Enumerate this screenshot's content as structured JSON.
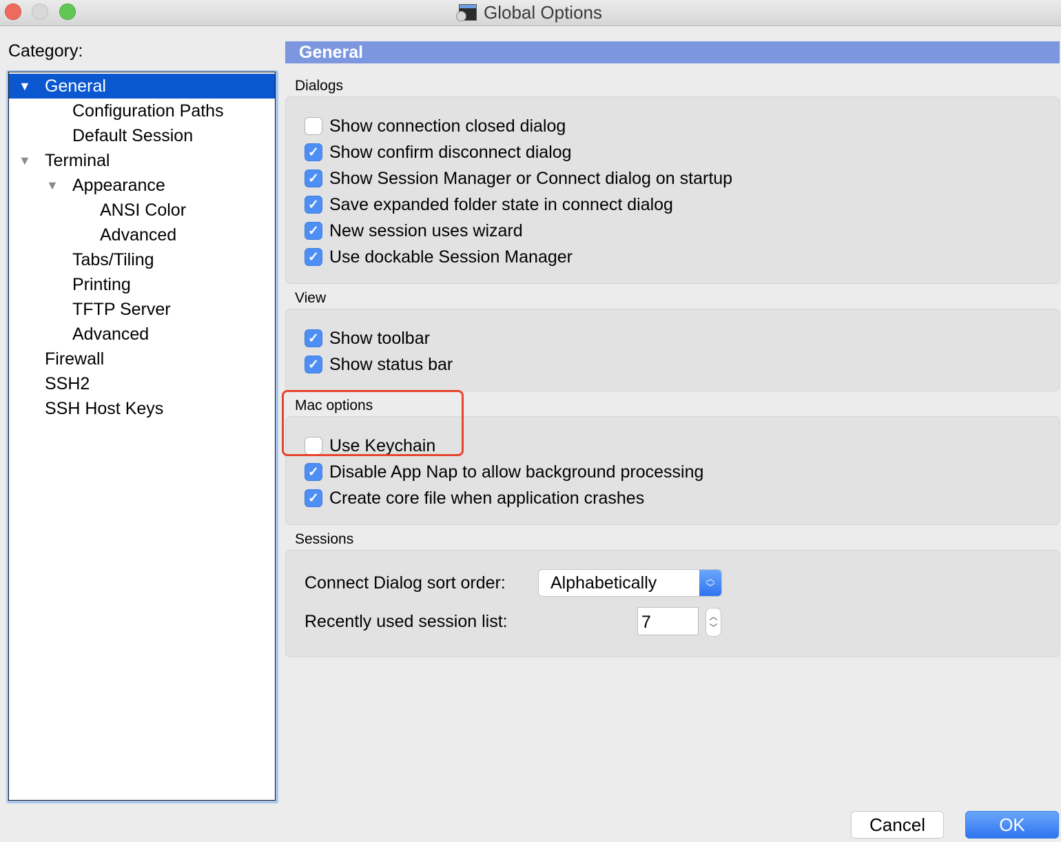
{
  "window": {
    "title": "Global Options",
    "title_icon": "securecrt-app-icon"
  },
  "category": {
    "label": "Category:",
    "items": [
      {
        "label": "General",
        "level": 0,
        "expanded": true,
        "selected": true
      },
      {
        "label": "Configuration Paths",
        "level": 1
      },
      {
        "label": "Default Session",
        "level": 1
      },
      {
        "label": "Terminal",
        "level": 0,
        "expanded": true
      },
      {
        "label": "Appearance",
        "level": 1,
        "expanded": true
      },
      {
        "label": "ANSI Color",
        "level": 2
      },
      {
        "label": "Advanced",
        "level": 2
      },
      {
        "label": "Tabs/Tiling",
        "level": 1
      },
      {
        "label": "Printing",
        "level": 1
      },
      {
        "label": "TFTP Server",
        "level": 1
      },
      {
        "label": "Advanced",
        "level": 1
      },
      {
        "label": "Firewall",
        "level": 0
      },
      {
        "label": "SSH2",
        "level": 0
      },
      {
        "label": "SSH Host Keys",
        "level": 0
      }
    ]
  },
  "panel": {
    "header": "General",
    "sections": {
      "dialogs": {
        "label": "Dialogs",
        "options": [
          {
            "label": "Show connection closed dialog",
            "checked": false
          },
          {
            "label": "Show confirm disconnect dialog",
            "checked": true
          },
          {
            "label": "Show Session Manager or Connect dialog on startup",
            "checked": true
          },
          {
            "label": "Save expanded folder state in connect dialog",
            "checked": true
          },
          {
            "label": "New session uses wizard",
            "checked": true
          },
          {
            "label": "Use dockable Session Manager",
            "checked": true
          }
        ]
      },
      "view": {
        "label": "View",
        "options": [
          {
            "label": "Show toolbar",
            "checked": true
          },
          {
            "label": "Show status bar",
            "checked": true
          }
        ]
      },
      "mac": {
        "label": "Mac options",
        "options": [
          {
            "label": "Use Keychain",
            "checked": false
          },
          {
            "label": "Disable App Nap to allow background processing",
            "checked": true
          },
          {
            "label": "Create core file when application crashes",
            "checked": true
          }
        ]
      },
      "sessions": {
        "label": "Sessions",
        "sort_order_label": "Connect Dialog sort order:",
        "sort_order_value": "Alphabetically",
        "recent_list_label": "Recently used session list:",
        "recent_list_value": "7"
      }
    }
  },
  "buttons": {
    "cancel": "Cancel",
    "ok": "OK"
  },
  "glyphs": {
    "check": "✓",
    "tri_down": "▼",
    "up": "︿",
    "down": "﹀"
  },
  "colors": {
    "accent": "#0b57d0",
    "header": "#7c97df",
    "checkbox": "#4d8ff5",
    "highlight": "#e8432f"
  }
}
